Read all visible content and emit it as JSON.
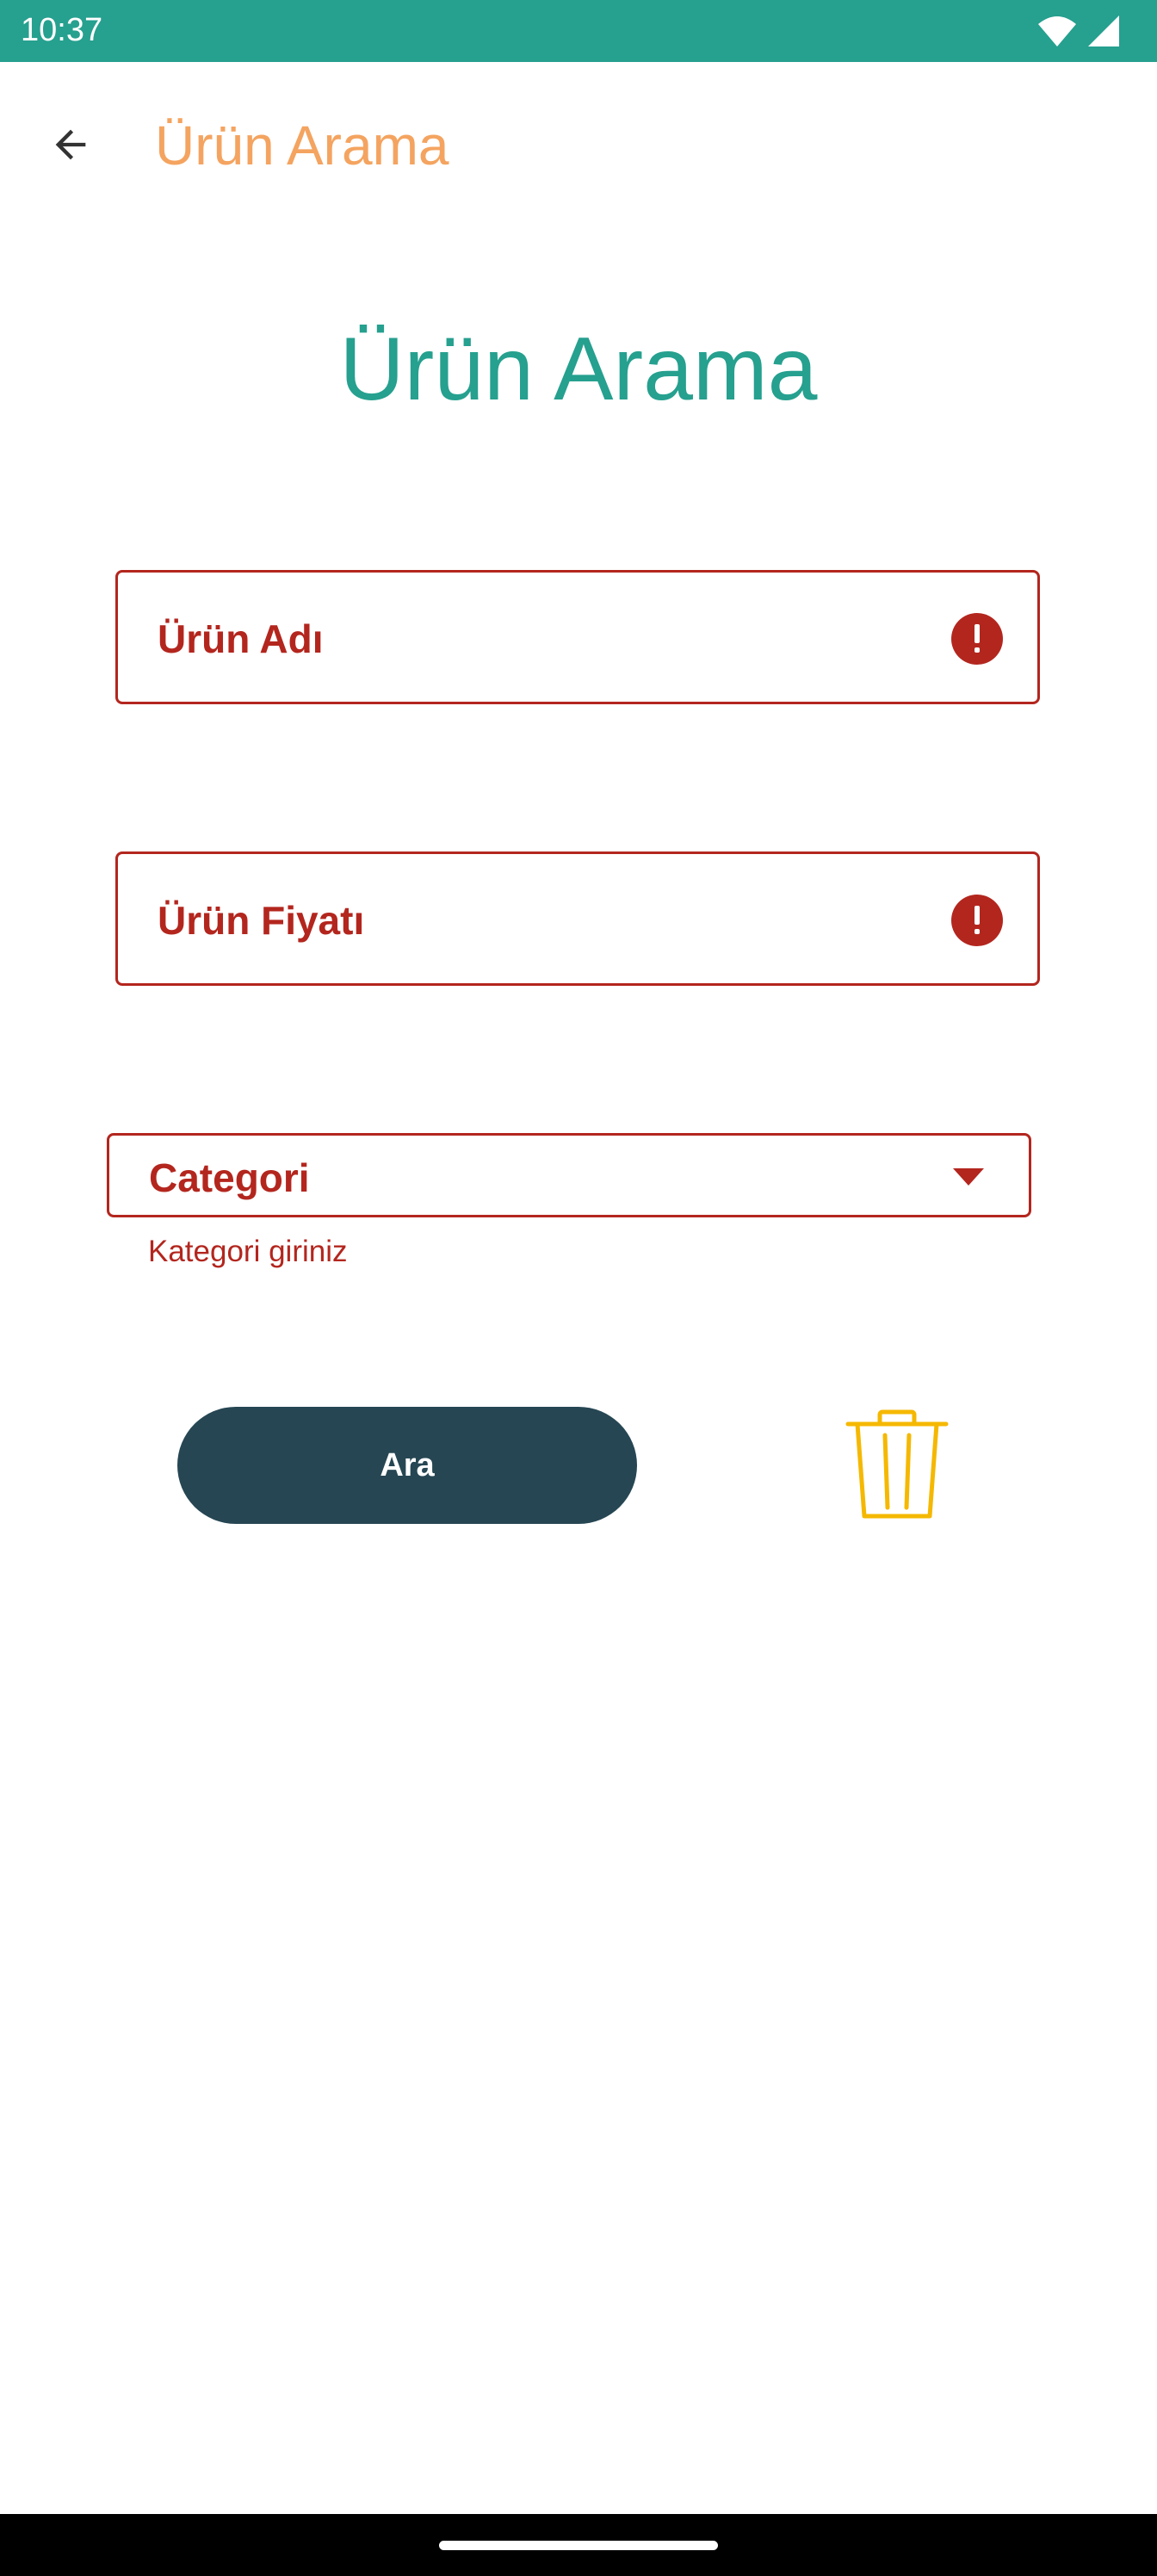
{
  "status_bar": {
    "time": "10:37",
    "icons": [
      "wifi-icon",
      "signal-icon"
    ]
  },
  "app_bar": {
    "back_icon": "arrow-back-icon",
    "title": "Ürün Arama"
  },
  "heading": "Ürün Arama",
  "form": {
    "product_name": {
      "label": "Ürün Adı",
      "icon": "error-icon",
      "state": "error"
    },
    "product_price": {
      "label": "Ürün Fiyatı",
      "icon": "error-icon",
      "state": "error"
    },
    "category": {
      "label": "Categori",
      "helper_text": "Kategori giriniz",
      "icon": "dropdown-arrow-icon",
      "state": "error"
    }
  },
  "actions": {
    "search_label": "Ara",
    "clear_icon": "trash-icon"
  },
  "colors": {
    "status_bar": "#26a08f",
    "app_bar_title": "#f4a460",
    "heading": "#26a08f",
    "error": "#b3261e",
    "search_button": "#264653",
    "trash_icon": "#f5b800"
  }
}
